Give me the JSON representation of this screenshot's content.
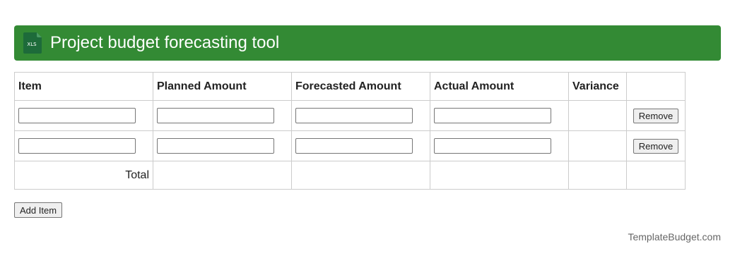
{
  "header": {
    "title": "Project budget forecasting tool",
    "icon": "xls-file-icon",
    "icon_text": "XLS",
    "color": "#338a34"
  },
  "table": {
    "columns": [
      "Item",
      "Planned Amount",
      "Forecasted Amount",
      "Actual Amount",
      "Variance",
      ""
    ],
    "rows": [
      {
        "item": "",
        "planned": "",
        "forecasted": "",
        "actual": "",
        "variance": "",
        "remove_label": "Remove"
      },
      {
        "item": "",
        "planned": "",
        "forecasted": "",
        "actual": "",
        "variance": "",
        "remove_label": "Remove"
      }
    ],
    "footer": {
      "label": "Total",
      "planned": "",
      "forecasted": "",
      "actual": "",
      "variance": ""
    }
  },
  "add_item_label": "Add Item",
  "brand": "TemplateBudget.com"
}
